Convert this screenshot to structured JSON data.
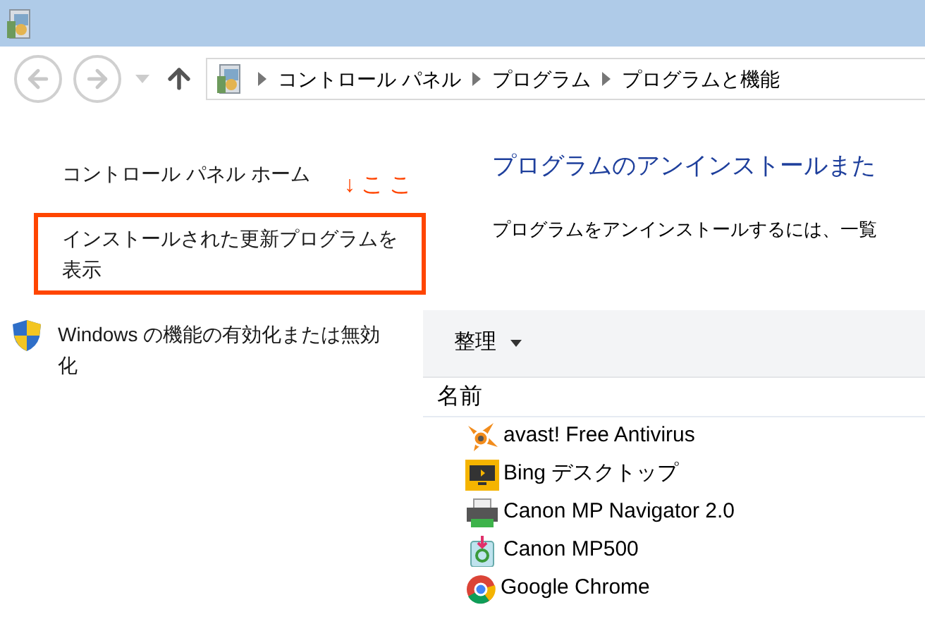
{
  "address_bar": {
    "breadcrumbs": [
      "コントロール パネル",
      "プログラム",
      "プログラムと機能"
    ]
  },
  "sidebar": {
    "items": [
      {
        "label": "コントロール パネル ホーム",
        "kind": "link",
        "highlighted": false
      },
      {
        "label": "インストールされた更新プログラムを表示",
        "kind": "link",
        "highlighted": true
      },
      {
        "label": "Windows の機能の有効化または無効化",
        "kind": "shield-link",
        "highlighted": false
      }
    ]
  },
  "annotation": {
    "text": "↓ここ"
  },
  "main": {
    "heading": "プログラムのアンインストールまた",
    "description": "プログラムをアンインストールするには、一覧"
  },
  "toolbar": {
    "organize": "整理"
  },
  "table": {
    "columns": [
      "名前"
    ],
    "rows": [
      {
        "name": "avast! Free Antivirus",
        "kind": "avast"
      },
      {
        "name": "Bing デスクトップ",
        "kind": "bing"
      },
      {
        "name": "Canon MP Navigator 2.0",
        "kind": "printer"
      },
      {
        "name": "Canon MP500",
        "kind": "installer"
      },
      {
        "name": "Google Chrome",
        "kind": "chrome"
      }
    ]
  }
}
